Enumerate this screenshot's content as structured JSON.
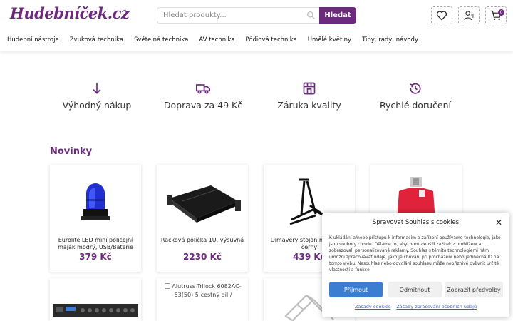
{
  "header": {
    "logo": "Hudebníček.cz",
    "search_placeholder": "Hledat produkty...",
    "search_button": "Hledat",
    "cart_count": "0",
    "icons": [
      "heart-icon",
      "user-icon",
      "cart-icon"
    ]
  },
  "nav": {
    "items": [
      "Hudební nástroje",
      "Zvuková technika",
      "Světelná technika",
      "AV technika",
      "Pódiová technika",
      "Umělé květiny",
      "Tipy, rady, návody"
    ]
  },
  "benefits": [
    {
      "label": "Výhodný nákup",
      "icon": "arrow-down-icon"
    },
    {
      "label": "Doprava za 49 Kč",
      "icon": "truck-icon"
    },
    {
      "label": "Záruka kvality",
      "icon": "store-icon"
    },
    {
      "label": "Rychlé doručení",
      "icon": "history-icon"
    }
  ],
  "section_title": "Novinky",
  "products": [
    {
      "name": "Eurolite LED mini policejní maják modrý, USB/Baterie",
      "price": "379 Kč"
    },
    {
      "name": "Racková polička 1U, výsuvná",
      "price": "2230 Kč"
    },
    {
      "name": "Dimavery stojan na kytaru, černý",
      "price": "439 Kč"
    },
    {
      "name": "",
      "price": ""
    }
  ],
  "products_row2": [
    {
      "alt": ""
    },
    {
      "alt": "Alutruss Trilock 6082AC-53(50) 5-cestný díl /"
    },
    {
      "alt": ""
    }
  ],
  "cookie": {
    "title": "Spravovat Souhlas s cookies",
    "text": "K ukládání a/nebo přístupu k informacím o zařízení používáme technologie, jako jsou soubory cookie. Děláme to, abychom zlepšili zážitek z prohlížení a zobrazovali personalizované reklamy. Souhlas s těmito technologiemi nám umožní zpracovávat údaje, jako je chování při procházení nebo jedinečná ID na tomto webu. Nesouhlas nebo odvolání souhlasu může nepříznivě ovlivnit určité vlastnosti a funkce.",
    "accept": "Přijmout",
    "deny": "Odmítnout",
    "preferences": "Zobrazit předvolby",
    "link_cookies": "Zásady cookies",
    "link_privacy": "Zásady zpracování osobních údajů"
  },
  "colors": {
    "brand": "#6b2a7c",
    "accept_button": "#3a7dd1"
  }
}
